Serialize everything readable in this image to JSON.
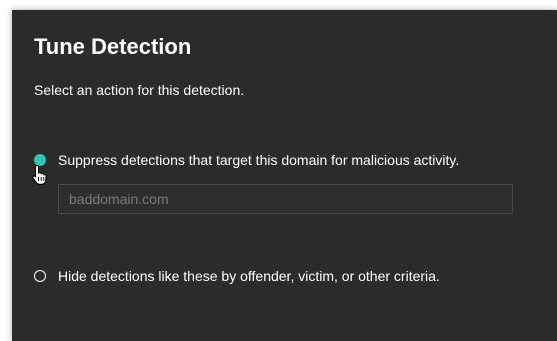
{
  "dialog": {
    "title": "Tune Detection",
    "subtitle": "Select an action for this detection."
  },
  "options": [
    {
      "label": "Suppress detections that target this domain for malicious activity.",
      "selected": true
    },
    {
      "label": "Hide detections like these by offender, victim, or other criteria.",
      "selected": false
    }
  ],
  "domain_input": {
    "value": "",
    "placeholder": "baddomain.com"
  },
  "colors": {
    "background": "#2b2b2b",
    "accent": "#2ec4b6",
    "text": "#ffffff",
    "placeholder": "#7b7b7b"
  },
  "icons": {
    "cursor": "hand-pointer-icon"
  }
}
